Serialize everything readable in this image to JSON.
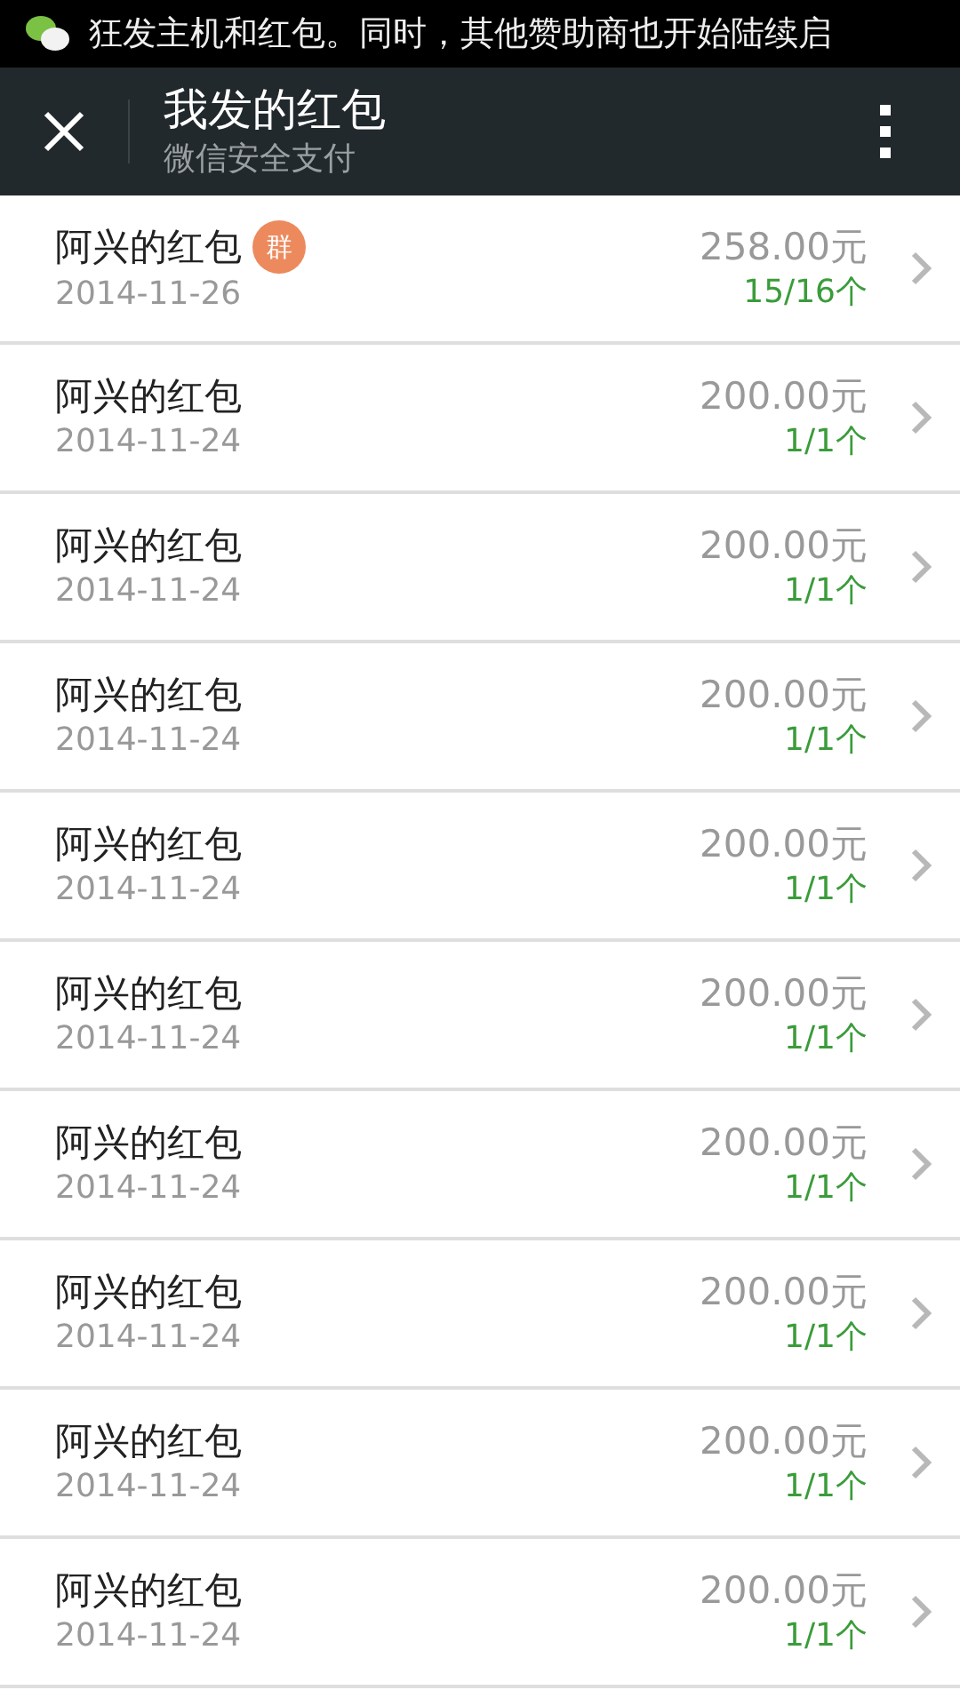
{
  "status_bar": {
    "notification": "狂发主机和红包。同时，其他赞助商也开始陆续启"
  },
  "header": {
    "title": "我发的红包",
    "subtitle": "微信安全支付"
  },
  "rows": [
    {
      "name": "阿兴的红包",
      "badge": "群",
      "date": "2014-11-26",
      "amount": "258.00元",
      "count": "15/16个"
    },
    {
      "name": "阿兴的红包",
      "date": "2014-11-24",
      "amount": "200.00元",
      "count": "1/1个"
    },
    {
      "name": "阿兴的红包",
      "date": "2014-11-24",
      "amount": "200.00元",
      "count": "1/1个"
    },
    {
      "name": "阿兴的红包",
      "date": "2014-11-24",
      "amount": "200.00元",
      "count": "1/1个"
    },
    {
      "name": "阿兴的红包",
      "date": "2014-11-24",
      "amount": "200.00元",
      "count": "1/1个"
    },
    {
      "name": "阿兴的红包",
      "date": "2014-11-24",
      "amount": "200.00元",
      "count": "1/1个"
    },
    {
      "name": "阿兴的红包",
      "date": "2014-11-24",
      "amount": "200.00元",
      "count": "1/1个"
    },
    {
      "name": "阿兴的红包",
      "date": "2014-11-24",
      "amount": "200.00元",
      "count": "1/1个"
    },
    {
      "name": "阿兴的红包",
      "date": "2014-11-24",
      "amount": "200.00元",
      "count": "1/1个"
    },
    {
      "name": "阿兴的红包",
      "date": "2014-11-24",
      "amount": "200.00元",
      "count": "1/1个"
    }
  ]
}
